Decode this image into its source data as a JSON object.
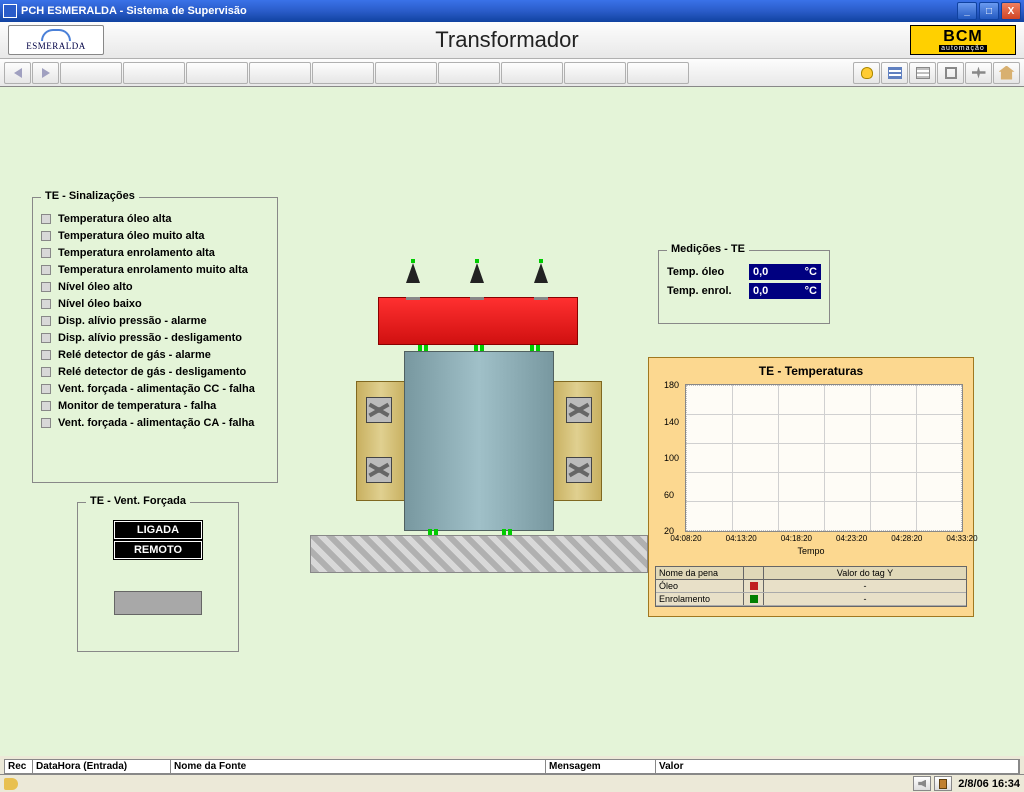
{
  "window_title": "PCH ESMERALDA - Sistema de Supervisão",
  "header": {
    "title": "Transformador",
    "logo_left": "ESMERALDA",
    "logo_right": "BCM",
    "logo_right_sub": "automação"
  },
  "signals": {
    "title": "TE - Sinalizações",
    "items": [
      "Temperatura óleo alta",
      "Temperatura óleo muito alta",
      "Temperatura enrolamento alta",
      "Temperatura enrolamento muito alta",
      "Nível óleo alto",
      "Nível óleo baixo",
      "Disp. alívio pressão - alarme",
      "Disp. alívio pressão - desligamento",
      "Relé detector de gás - alarme",
      "Relé detector de gás - desligamento",
      "Vent. forçada - alimentação CC - falha",
      "Monitor de temperatura - falha",
      "Vent. forçada - alimentação CA - falha"
    ]
  },
  "vent": {
    "title": "TE - Vent. Forçada",
    "btn_on": "LIGADA",
    "btn_mode": "REMOTO"
  },
  "measures": {
    "title": "Medições - TE",
    "rows": [
      {
        "label": "Temp. óleo",
        "value": "0,0",
        "unit": "°C"
      },
      {
        "label": "Temp. enrol.",
        "value": "0,0",
        "unit": "°C"
      }
    ]
  },
  "chart_data": {
    "type": "line",
    "title": "TE - Temperaturas",
    "xlabel": "Tempo",
    "ylabel": "",
    "ylim": [
      20,
      180
    ],
    "y_ticks": [
      180,
      140,
      100,
      60,
      20
    ],
    "x_ticks": [
      "04:08:20",
      "04:13:20",
      "04:18:20",
      "04:23:20",
      "04:28:20",
      "04:33:20"
    ],
    "series": [
      {
        "name": "Óleo",
        "color": "#c02020",
        "values": []
      },
      {
        "name": "Enrolamento",
        "color": "#008000",
        "values": []
      }
    ],
    "legend_headers": {
      "pen": "Nome da pena",
      "val": "Valor do tag Y"
    },
    "legend_placeholder": "-"
  },
  "status_cols": {
    "rec": "Rec",
    "dh": "DataHora (Entrada)",
    "nf": "Nome da Fonte",
    "msg": "Mensagem",
    "val": "Valor"
  },
  "datetime": "2/8/06 16:34"
}
